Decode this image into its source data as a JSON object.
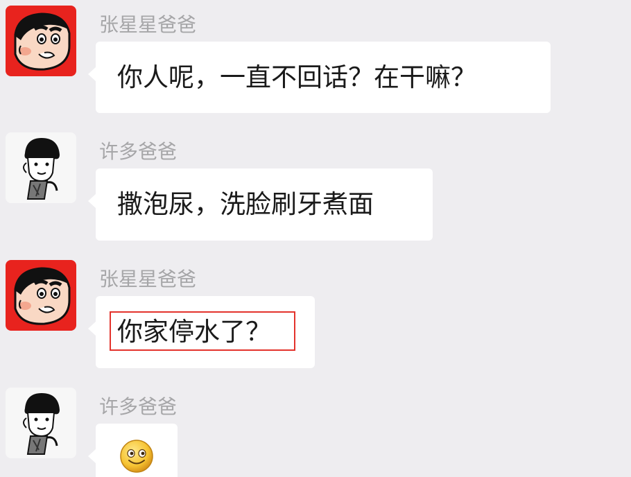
{
  "messages": [
    {
      "sender": "张星星爸爸",
      "avatar": "shinchan-avatar",
      "text": "你人呢，一直不回话？在干嘛？"
    },
    {
      "sender": "许多爸爸",
      "avatar": "cartoon-boy-avatar",
      "text": "撒泡尿，洗脸刷牙煮面"
    },
    {
      "sender": "张星星爸爸",
      "avatar": "shinchan-avatar",
      "text": "你家停水了？",
      "highlighted": true
    },
    {
      "sender": "许多爸爸",
      "avatar": "cartoon-boy-avatar",
      "emoji": "smiley-emoji-icon"
    }
  ],
  "colors": {
    "background": "#eeedf0",
    "bubble": "#ffffff",
    "sender_name": "#a6a6a8",
    "highlight_border": "#e3322b",
    "red_avatar": "#e8231e"
  }
}
